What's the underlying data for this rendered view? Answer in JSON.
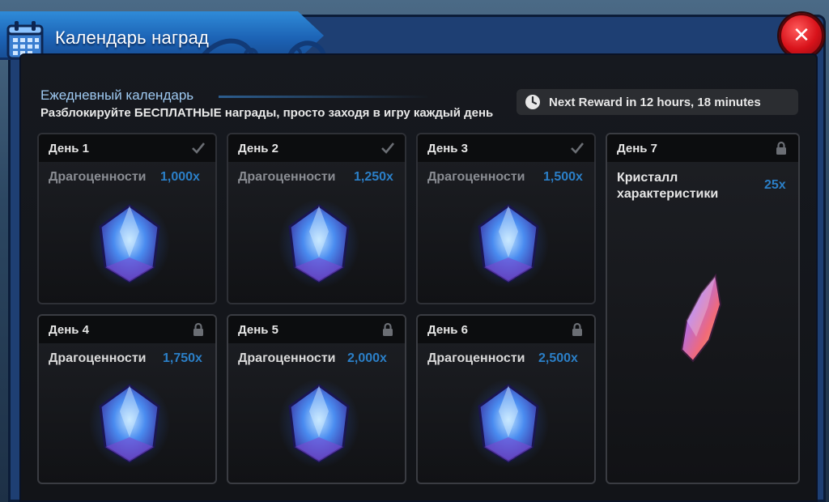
{
  "window": {
    "title": "Календарь наград",
    "close_label": "✕"
  },
  "section": {
    "title": "Ежедневный календарь",
    "description": "Разблокируйте БЕСПЛАТНЫЕ награды, просто заходя в игру каждый день"
  },
  "timer": {
    "text": "Next Reward in 12 hours, 18 minutes"
  },
  "days": [
    {
      "label": "День 1",
      "reward": "Драгоценности",
      "qty": "1,000x",
      "status": "claimed"
    },
    {
      "label": "День 2",
      "reward": "Драгоценности",
      "qty": "1,250x",
      "status": "claimed"
    },
    {
      "label": "День 3",
      "reward": "Драгоценности",
      "qty": "1,500x",
      "status": "claimed"
    },
    {
      "label": "День 4",
      "reward": "Драгоценности",
      "qty": "1,750x",
      "status": "locked"
    },
    {
      "label": "День 5",
      "reward": "Драгоценности",
      "qty": "2,000x",
      "status": "locked"
    },
    {
      "label": "День 6",
      "reward": "Драгоценности",
      "qty": "2,500x",
      "status": "locked"
    }
  ],
  "day7": {
    "label": "День 7",
    "reward": "Кристалл характеристики",
    "qty": "25x",
    "status": "locked"
  },
  "colors": {
    "frame": "#1e3f73",
    "banner": "#1c62b4",
    "close": "#d8121a",
    "qty": "#2b7fc7"
  }
}
